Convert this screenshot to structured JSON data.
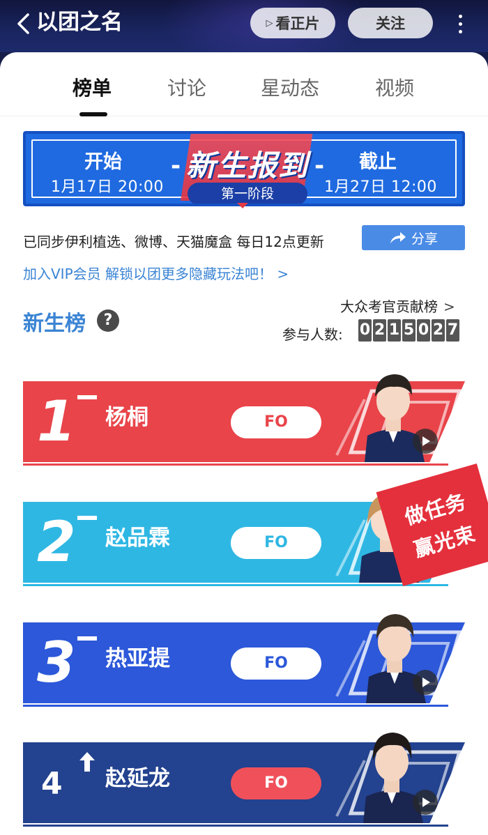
{
  "header": {
    "title": "以团之名",
    "watch_label": "看正片",
    "watch_icon": "play-triangle-icon",
    "follow_label": "关注",
    "more_icon": "vertical-dots-icon"
  },
  "tabs": [
    {
      "label": "榜单",
      "active": true
    },
    {
      "label": "讨论",
      "active": false
    },
    {
      "label": "星动态",
      "active": false
    },
    {
      "label": "视频",
      "active": false
    }
  ],
  "banner": {
    "start_label": "开始",
    "start_time": "1月17日 20:00",
    "title": "新生报到",
    "stage": "第一阶段",
    "end_label": "截止",
    "end_time": "1月27日 12:00"
  },
  "sync_text": "已同步伊利植选、微博、天猫魔盒 每日12点更新",
  "share_label": "分享",
  "vip_text": "加入VIP会员 解锁以团更多隐藏玩法吧！ >",
  "board": {
    "title": "新生榜",
    "help_icon": "?",
    "contributors_link": "大众考官贡献榜",
    "contributors_chevron": ">",
    "participants_label": "参与人数:",
    "participants_digits": [
      "0",
      "2",
      "1",
      "5",
      "0",
      "2",
      "7"
    ]
  },
  "ranking": [
    {
      "rank": "1",
      "name": "杨桐",
      "fo": "FO",
      "trend": "same",
      "color": "#e8444a"
    },
    {
      "rank": "2",
      "name": "赵品霖",
      "fo": "FO",
      "trend": "same",
      "color": "#2fb7e3"
    },
    {
      "rank": "3",
      "name": "热亚提",
      "fo": "FO",
      "trend": "same",
      "color": "#2c58d9"
    },
    {
      "rank": "4",
      "name": "赵延龙",
      "fo": "FO",
      "trend": "up",
      "color": "#23428f"
    }
  ],
  "task_badge": {
    "line1": "做任务",
    "line2": "赢光束"
  },
  "colors": {
    "accent_blue": "#3b84d4",
    "banner_blue": "#1f6ae0",
    "task_red": "#e4303c",
    "fo_red": "#f0505a"
  }
}
